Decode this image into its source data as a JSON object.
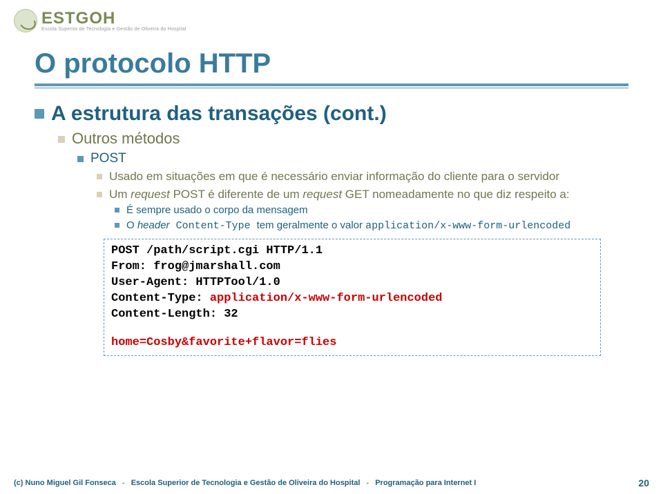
{
  "logo": {
    "main": "ESTGOH",
    "sub": "Escola Superior de Tecnologia e Gestão de Oliveira do Hospital"
  },
  "title": "O protocolo HTTP",
  "subtitle": "A estrutura das transações (cont.)",
  "l2": "Outros métodos",
  "l3": "POST",
  "l4a": "Usado em situações em que é necessário enviar informação do cliente para o servidor",
  "l4b_prefix": "Um ",
  "l4b_req1": "request",
  "l4b_mid1": " POST é diferente de um ",
  "l4b_req2": "request",
  "l4b_mid2": " GET nomeadamente no que diz respeito a:",
  "l5a": "É sempre usado o corpo da mensagem",
  "l5b_prefix": "O ",
  "l5b_header": "header",
  "l5b_ct": " Content-Type ",
  "l5b_mid": "tem geralmente o valor ",
  "l5b_val": "application/x-www-form-urlencoded",
  "code": {
    "line1": "POST /path/script.cgi HTTP/1.1",
    "line2": "From: frog@jmarshall.com",
    "line3": "User-Agent: HTTPTool/1.0",
    "line4a": "Content-Type: ",
    "line4b": "application/x-www-form-urlencoded",
    "line5": "Content-Length: 32",
    "line6": "home=Cosby&favorite+flavor=flies"
  },
  "footer": {
    "author": "(c) Nuno Miguel Gil Fonseca",
    "school": "Escola Superior de Tecnologia e Gestão de Oliveira do Hospital",
    "course": "Programação para Internet I",
    "page": "20"
  }
}
